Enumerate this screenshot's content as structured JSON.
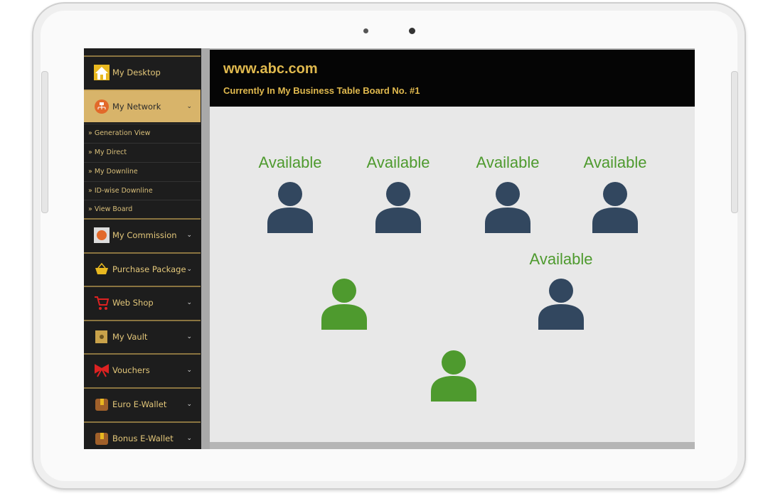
{
  "header": {
    "site": "www.abc.com",
    "board": "Currently In My Business Table Board No. #1"
  },
  "sidebar": {
    "items": [
      {
        "label": "My Desktop",
        "icon": "house-icon"
      },
      {
        "label": "My Network",
        "icon": "network-icon",
        "active": true
      },
      {
        "label": "My Commission",
        "icon": "commission-icon"
      },
      {
        "label": "Purchase Package",
        "icon": "basket-icon"
      },
      {
        "label": "Web Shop",
        "icon": "cart-icon"
      },
      {
        "label": "My Vault",
        "icon": "vault-icon"
      },
      {
        "label": "Vouchers",
        "icon": "bow-icon"
      },
      {
        "label": "Euro E-Wallet",
        "icon": "wallet-icon"
      },
      {
        "label": "Bonus E-Wallet",
        "icon": "wallet-icon"
      }
    ],
    "subitems": [
      "» Generation View",
      "» My Direct",
      "» My Downline",
      "» ID-wise Downline",
      "» View Board"
    ]
  },
  "board": {
    "available_label": "Available",
    "colors": {
      "available": "#32475f",
      "occupied": "#4e9a2e",
      "label": "#4e9a2e"
    }
  }
}
